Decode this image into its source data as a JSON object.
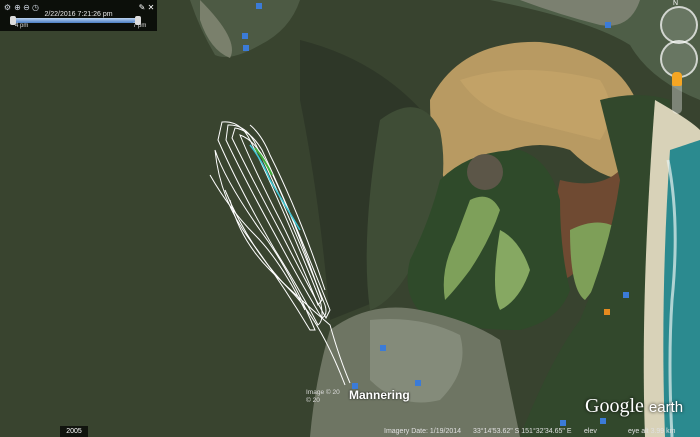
{
  "time_slider": {
    "date_time": "2/22/2016   7:21:26 pm",
    "start_label": "4 pm",
    "end_label": "7 pm"
  },
  "map": {
    "place_label": "Mannering",
    "credits": [
      "Image © 20",
      "© 20"
    ]
  },
  "imagery_year": "2005",
  "status_bar": {
    "imagery_date": "Imagery Date: 1/19/2014",
    "coords": "33°14'53.62\" S  151°32'34.65\" E",
    "elev": "elev",
    "eye_alt": "eye alt   3.99 km"
  },
  "logo": {
    "google": "Google",
    "earth": "earth"
  },
  "colors": {
    "water": "#38432f",
    "track": "#ffffff",
    "track_accent": "#3fc7d6",
    "track_green": "#3fae3b",
    "sand": "#b89a62"
  }
}
